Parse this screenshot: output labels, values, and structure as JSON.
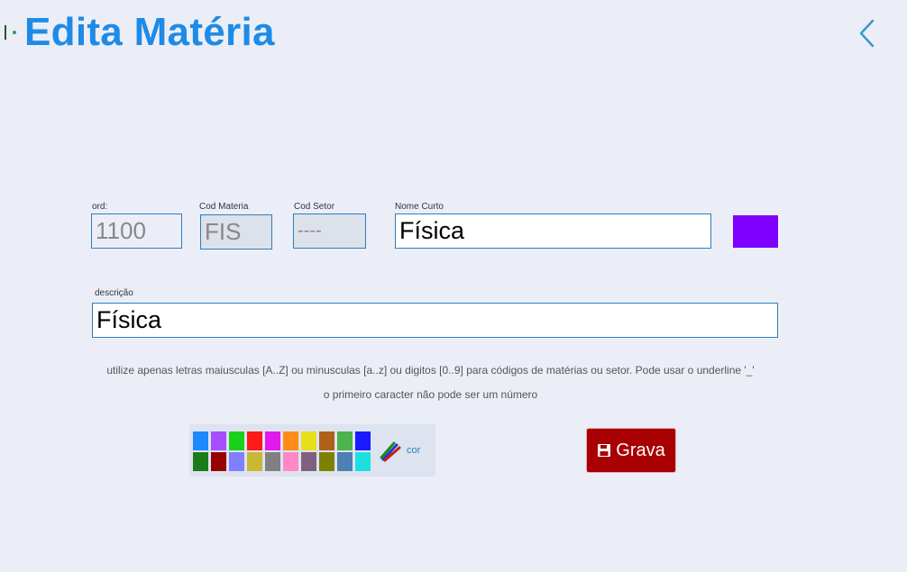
{
  "page": {
    "title": "Edita Matéria"
  },
  "icons": {
    "back": "chevron-left-icon",
    "logo": "logo-icon",
    "save": "floppy-disk-icon",
    "palette": "pencils-icon"
  },
  "form": {
    "ord": {
      "label": "ord:",
      "value": "1100"
    },
    "cod_materia": {
      "label": "Cod Materia",
      "value": "FIS"
    },
    "cod_setor": {
      "label": "Cod Setor",
      "value": "----"
    },
    "nome_curto": {
      "label": "Nome Curto",
      "value": "Física"
    },
    "descricao": {
      "label": "descrição",
      "value": "Física"
    },
    "selected_color": "#7f00ff"
  },
  "hints": {
    "line1": "utilize apenas letras maiusculas [A..Z]  ou minusculas [a..z]  ou digitos [0..9] para códigos de matérias ou setor.  Pode usar o underline '_'",
    "line2": "o primeiro caracter não pode ser um número"
  },
  "palette": {
    "row1": [
      "#1e88ff",
      "#a64dff",
      "#1ad11a",
      "#ff1a1a",
      "#e01aeb",
      "#ff8c1a",
      "#e6e01a",
      "#b0601a",
      "#4db34d",
      "#1a1aff"
    ],
    "row2": [
      "#1a7d1a",
      "#990000",
      "#8080ff",
      "#c8b833",
      "#808080",
      "#ff88c8",
      "#806080",
      "#808000",
      "#4d80b3",
      "#1ae0e0"
    ],
    "link_label": "cor"
  },
  "actions": {
    "save_label": "Grava"
  },
  "colors": {
    "accent": "#1e8be6",
    "border": "#2a7fc1",
    "save_bg": "#a80003",
    "bg": "#ebeef6"
  }
}
